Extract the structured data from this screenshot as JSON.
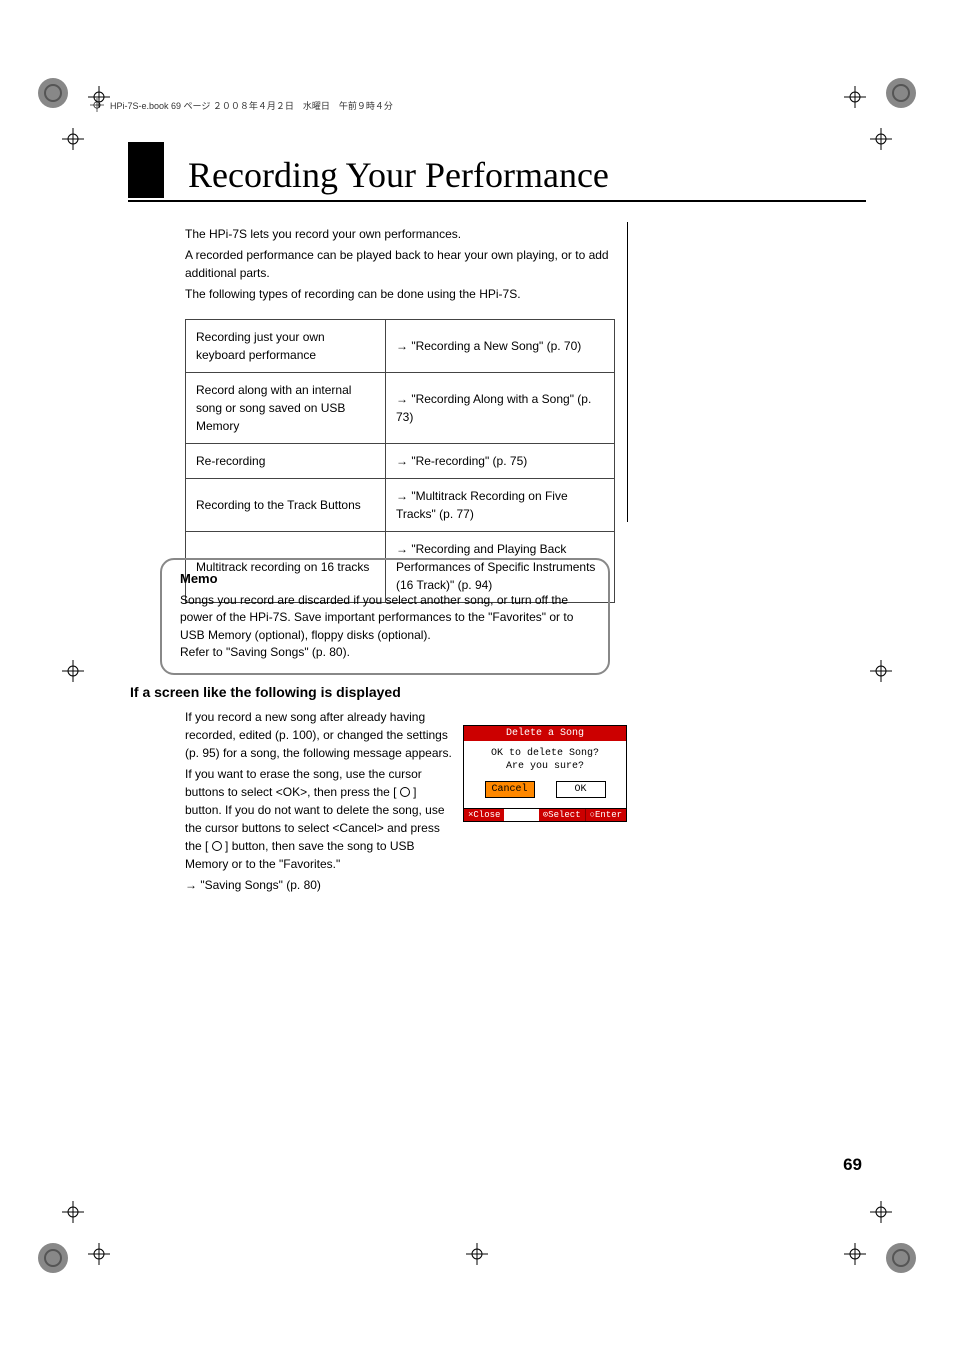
{
  "header_line": "HPi-7S-e.book  69 ページ  ２００８年４月２日　水曜日　午前９時４分",
  "page_title": "Recording Your Performance",
  "intro": {
    "p1": "The HPi-7S lets you record your own performances.",
    "p2": "A recorded performance can be played back to hear your own playing, or to add additional parts.",
    "p3": "The following types of recording can be done using the HPi-7S."
  },
  "table": [
    {
      "left": "Recording just your own keyboard performance",
      "right": "→ \"Recording a New Song\" (p. 70)"
    },
    {
      "left": "Record along with an internal song or song saved on USB Memory",
      "right": "→ \"Recording Along with a Song\" (p. 73)"
    },
    {
      "left": "Re-recording",
      "right": "→ \"Re-recording\" (p. 75)"
    },
    {
      "left": "Recording to the Track Buttons",
      "right": "→ \"Multitrack Recording on Five Tracks\" (p. 77)"
    },
    {
      "left": "Multitrack recording on 16 tracks",
      "right": "→ \"Recording and Playing Back Performances of Specific Instruments (16 Track)\" (p. 94)"
    }
  ],
  "memo": {
    "title": "Memo",
    "body1": "Songs you record are discarded if you select another song, or turn off the power of the HPi-7S. Save important performances to the \"Favorites\" or to USB Memory (optional), floppy disks (optional).",
    "body2": "Refer to \"Saving Songs\" (p. 80)."
  },
  "section2": {
    "title": "If a screen like the following is displayed",
    "p1": "If you record a new song after already having recorded, edited (p. 100), or changed the settings (p. 95) for a song, the following message appears.",
    "p2a": "If you want to erase the song, use the cursor buttons to select <OK>, then press the [",
    "p2b": "] button. If you do not want to delete the song, use the cursor buttons to select <Cancel> and press the [",
    "p2c": "] button, then save the song to USB Memory or to the \"Favorites.\"",
    "p3": "→ \"Saving Songs\" (p. 80)"
  },
  "dialog": {
    "title": "Delete a Song",
    "line1": "OK to delete Song?",
    "line2": "Are you sure?",
    "cancel": "Cancel",
    "ok": "OK",
    "close": "×Close",
    "select": "⊙Select",
    "enter": "○Enter"
  },
  "page_number": "69"
}
